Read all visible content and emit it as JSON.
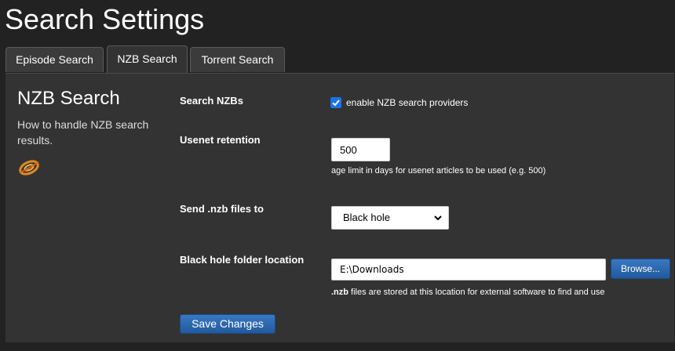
{
  "page_title": "Search Settings",
  "tabs": [
    {
      "label": "Episode Search",
      "active": false
    },
    {
      "label": "NZB Search",
      "active": true
    },
    {
      "label": "Torrent Search",
      "active": false
    }
  ],
  "sidebar": {
    "title": "NZB Search",
    "description": "How to handle NZB search results.",
    "icon": "nzb-logo-icon"
  },
  "form": {
    "search_nzbs": {
      "label": "Search NZBs",
      "checkbox_label": "enable NZB search providers",
      "checked": true
    },
    "usenet_retention": {
      "label": "Usenet retention",
      "value": "500",
      "help": "age limit in days for usenet articles to be used (e.g. 500)"
    },
    "send_nzb_to": {
      "label": "Send .nzb files to",
      "selected": "Black hole"
    },
    "black_hole_folder": {
      "label": "Black hole folder location",
      "value": "E:\\Downloads",
      "browse_label": "Browse...",
      "help_bold": ".nzb",
      "help_rest": " files are stored at this location for external software to find and use"
    },
    "save_label": "Save Changes"
  },
  "colors": {
    "background": "#222222",
    "panel": "#333333",
    "accent_button": "#2f6bb3",
    "checkbox": "#1a73e8"
  }
}
